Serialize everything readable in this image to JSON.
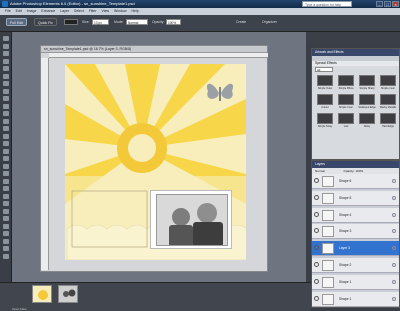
{
  "window": {
    "title": "Adobe Photoshop Elements 6.0 (Editor) - sn_sunshine_Template1.psd",
    "help_placeholder": "Type a question for help"
  },
  "menu": [
    "File",
    "Edit",
    "Image",
    "Enhance",
    "Layer",
    "Select",
    "Filter",
    "View",
    "Window",
    "Help"
  ],
  "options": {
    "full_edit": "Full Edit",
    "quick_fix": "Quick Fix",
    "size_label": "Size:",
    "size_value": "13 px",
    "mode_label": "Mode:",
    "mode_value": "Normal",
    "opacity_label": "Opacity:",
    "opacity_value": "100%",
    "create": "Create",
    "organizer": "Organizer"
  },
  "document": {
    "title": "sn_sunshine_Template1.psd @ 16.7% (Layer 3, RGB/8)"
  },
  "effects": {
    "title": "Artwork and Effects",
    "subtitle": "Special Effects",
    "filter": "All",
    "items": [
      "Simple Outer",
      "Simple Pillow",
      "Simple Sharp",
      "Simple Inner",
      "Cutout",
      "Simple Inner",
      "Scalloped Edge",
      "Wacky Metallic",
      "Simple Noisy",
      "Low",
      "Noisy",
      "Hard Edge"
    ]
  },
  "layers": {
    "title": "Layers",
    "mode": "Normal",
    "opacity_label": "Opacity:",
    "opacity": "100%",
    "rows": [
      {
        "name": "Shape 6"
      },
      {
        "name": "Shape 5"
      },
      {
        "name": "Shape 4"
      },
      {
        "name": "Shape 3"
      },
      {
        "name": "Layer 3"
      },
      {
        "name": "Shape 2"
      },
      {
        "name": "Shape 1"
      },
      {
        "name": "Shape 1"
      }
    ]
  },
  "bin": {
    "status": "Open Files"
  },
  "colors": {
    "sun": "#f7d43e",
    "bg": "#f7eebc",
    "selected": "#3373d0"
  }
}
